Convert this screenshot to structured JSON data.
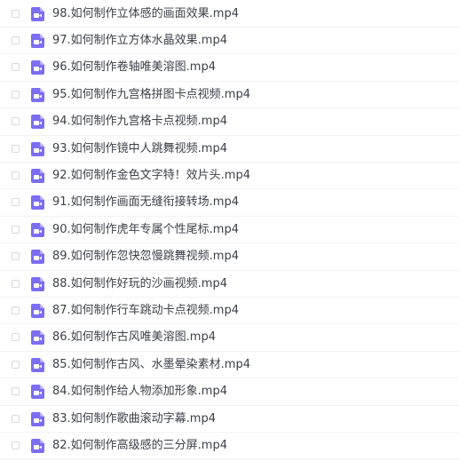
{
  "icon": {
    "name": "video-file-icon",
    "color": "#7b6ef2"
  },
  "files": [
    {
      "name": "98.如何制作立体感的画面效果.mp4"
    },
    {
      "name": "97.如何制作立方体水晶效果.mp4"
    },
    {
      "name": "96.如何制作卷轴唯美溶图.mp4"
    },
    {
      "name": "95.如何制作九宫格拼图卡点视频.mp4"
    },
    {
      "name": "94.如何制作九宫格卡点视频.mp4"
    },
    {
      "name": "93.如何制作镜中人跳舞视频.mp4"
    },
    {
      "name": "92.如何制作金色文字特！效片头.mp4"
    },
    {
      "name": "91.如何制作画面无缝衔接转场.mp4"
    },
    {
      "name": "90.如何制作虎年专属个性尾标.mp4"
    },
    {
      "name": "89.如何制作忽快忽慢跳舞视频.mp4"
    },
    {
      "name": "88.如何制作好玩的沙画视频.mp4"
    },
    {
      "name": "87.如何制作行车跳动卡点视频.mp4"
    },
    {
      "name": "86.如何制作古风唯美溶图.mp4"
    },
    {
      "name": "85.如何制作古风、水墨晕染素材.mp4"
    },
    {
      "name": "84.如何制作给人物添加形象.mp4"
    },
    {
      "name": "83.如何制作歌曲滚动字幕.mp4"
    },
    {
      "name": "82.如何制作高级感的三分屏.mp4"
    }
  ]
}
